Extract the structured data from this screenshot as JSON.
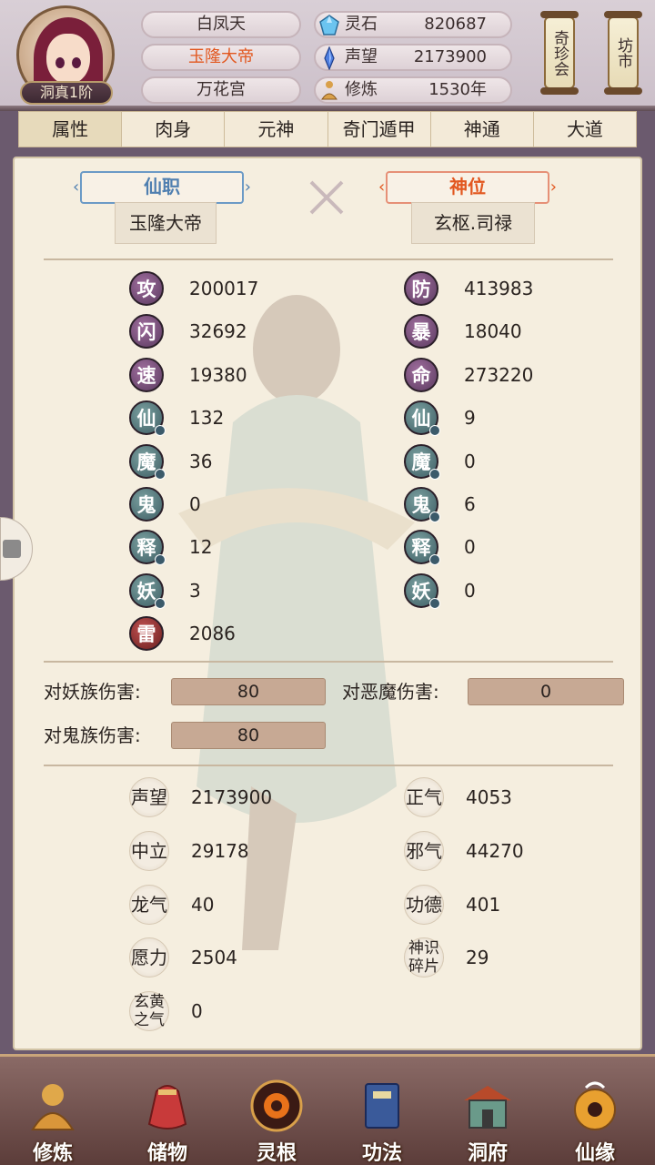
{
  "header": {
    "rank": "洞真1阶",
    "name": "白凤天",
    "title": "玉隆大帝",
    "sect": "万花宫",
    "resources": [
      {
        "icon": "spirit-stone-icon",
        "label": "灵石",
        "value": "820687"
      },
      {
        "icon": "prestige-crystal-icon",
        "label": "声望",
        "value": "2173900"
      },
      {
        "icon": "meditation-icon",
        "label": "修炼",
        "value": "1530年"
      }
    ],
    "shortcut_treasure": "奇珍会",
    "shortcut_market": "坊市"
  },
  "tabs": [
    "属性",
    "肉身",
    "元神",
    "奇门遁甲",
    "神通",
    "大道"
  ],
  "titles": {
    "immortal_post_label": "仙职",
    "immortal_post_value": "玉隆大帝",
    "divine_rank_label": "神位",
    "divine_rank_value": "玄枢.司禄"
  },
  "stats_left": [
    {
      "glyph": "攻",
      "value": "200017",
      "color": "purple",
      "dot": false
    },
    {
      "glyph": "闪",
      "value": "32692",
      "color": "purple",
      "dot": false
    },
    {
      "glyph": "速",
      "value": "19380",
      "color": "purple",
      "dot": false
    },
    {
      "glyph": "仙",
      "value": "132",
      "color": "teal",
      "dot": true
    },
    {
      "glyph": "魔",
      "value": "36",
      "color": "teal",
      "dot": true
    },
    {
      "glyph": "鬼",
      "value": "0",
      "color": "teal",
      "dot": false
    },
    {
      "glyph": "释",
      "value": "12",
      "color": "teal",
      "dot": true
    },
    {
      "glyph": "妖",
      "value": "3",
      "color": "teal",
      "dot": true
    },
    {
      "glyph": "雷",
      "value": "2086",
      "color": "red",
      "dot": false
    }
  ],
  "stats_right": [
    {
      "glyph": "防",
      "value": "413983",
      "color": "purple",
      "dot": false
    },
    {
      "glyph": "暴",
      "value": "18040",
      "color": "purple",
      "dot": false
    },
    {
      "glyph": "命",
      "value": "273220",
      "color": "purple",
      "dot": false
    },
    {
      "glyph": "仙",
      "value": "9",
      "color": "teal",
      "dot": true
    },
    {
      "glyph": "魔",
      "value": "0",
      "color": "teal",
      "dot": true
    },
    {
      "glyph": "鬼",
      "value": "6",
      "color": "teal",
      "dot": true
    },
    {
      "glyph": "释",
      "value": "0",
      "color": "teal",
      "dot": true
    },
    {
      "glyph": "妖",
      "value": "0",
      "color": "teal",
      "dot": true
    }
  ],
  "damage": {
    "demon_race_label": "对妖族伤害:",
    "demon_race_value": "80",
    "evil_demon_label": "对恶魔伤害:",
    "evil_demon_value": "0",
    "ghost_race_label": "对鬼族伤害:",
    "ghost_race_value": "80"
  },
  "reputation": [
    {
      "label": "声望",
      "value": "2173900"
    },
    {
      "label": "正气",
      "value": "4053"
    },
    {
      "label": "中立",
      "value": "29178"
    },
    {
      "label": "邪气",
      "value": "44270"
    },
    {
      "label": "龙气",
      "value": "40"
    },
    {
      "label": "功德",
      "value": "401"
    },
    {
      "label": "愿力",
      "value": "2504"
    },
    {
      "label": "神识碎片",
      "value": "29"
    },
    {
      "label": "玄黄之气",
      "value": "0"
    }
  ],
  "bottom_nav": [
    {
      "label": "修炼",
      "icon": "cultivation-icon"
    },
    {
      "label": "储物",
      "icon": "storage-bag-icon"
    },
    {
      "label": "灵根",
      "icon": "spirit-root-icon"
    },
    {
      "label": "功法",
      "icon": "technique-book-icon"
    },
    {
      "label": "洞府",
      "icon": "cave-dwelling-icon"
    },
    {
      "label": "仙缘",
      "icon": "immortal-fate-icon"
    }
  ],
  "colors": {
    "accent_orange": "#e2571f",
    "immortal_post_blue": "#4f7fb0",
    "divine_rank_red": "#e2571f",
    "stat_purple": "#5a3a5f",
    "stat_teal": "#3f5e64",
    "stat_red": "#6a2020"
  }
}
